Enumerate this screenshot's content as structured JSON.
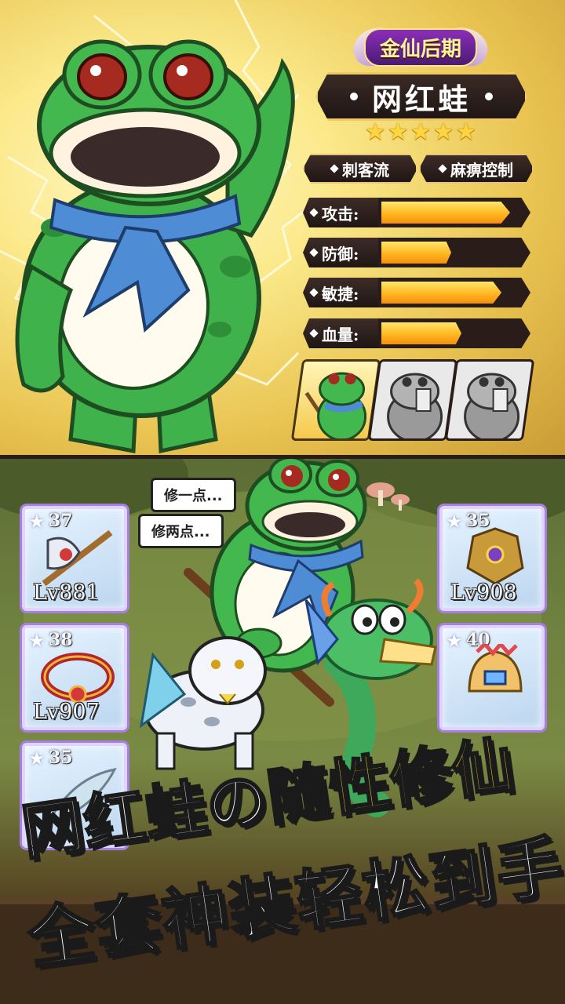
{
  "hero": {
    "rank": "金仙后期",
    "name": "网红蛙",
    "stars": [
      "★",
      "★",
      "★",
      "★",
      "★"
    ],
    "tags": [
      "刺客流",
      "麻痹控制"
    ],
    "stats": [
      {
        "label": "攻击:",
        "level": 0.88
      },
      {
        "label": "防御:",
        "level": 0.48
      },
      {
        "label": "敏捷:",
        "level": 0.82
      },
      {
        "label": "血量:",
        "level": 0.55
      }
    ],
    "skins": [
      {
        "state": "selected"
      },
      {
        "state": "locked"
      },
      {
        "state": "locked"
      }
    ]
  },
  "scene": {
    "speech": [
      "修一点...",
      "修两点..."
    ],
    "equipment_left": [
      {
        "stars": "37",
        "level": "Lv881",
        "icon": "axe-icon"
      },
      {
        "stars": "38",
        "level": "Lv907",
        "icon": "ring-icon"
      },
      {
        "stars": "35",
        "level": "",
        "icon": "wing-icon"
      }
    ],
    "equipment_right": [
      {
        "stars": "35",
        "level": "Lv908",
        "icon": "armor-icon"
      },
      {
        "stars": "40",
        "level": "",
        "icon": "helmet-icon"
      }
    ]
  },
  "slogan": {
    "line1_a": "网红蛙の",
    "line1_b": "随性修仙",
    "line2": "全套神装轻松到手"
  },
  "colors": {
    "bar_fill": "#ffb722",
    "frame_dark": "#2a1d19",
    "slogan_yellow": "#ffde27"
  }
}
